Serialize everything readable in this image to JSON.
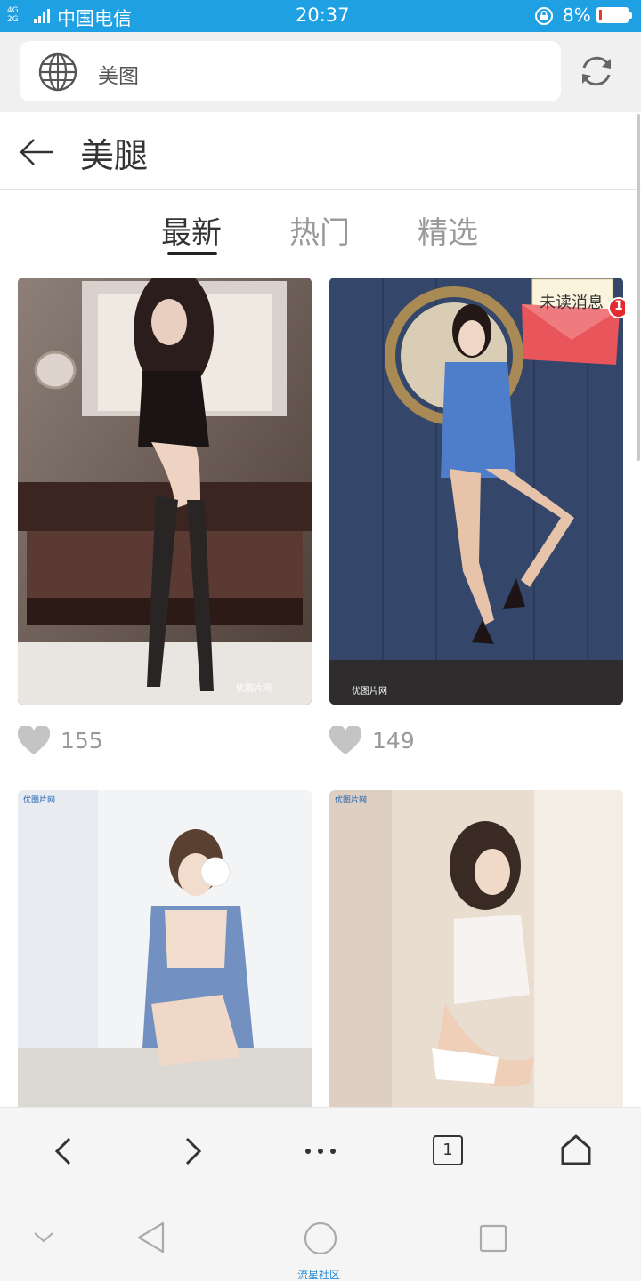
{
  "status_bar": {
    "network": [
      "4G",
      "2G"
    ],
    "carrier": "中国电信",
    "time": "20:37",
    "battery_percent": "8%",
    "battery_level": 0.08,
    "accent_color": "#1fa0e3"
  },
  "address_bar": {
    "text": "美图",
    "site_icon": "globe-icon",
    "action_icon": "refresh-icon"
  },
  "header": {
    "title": "美腿",
    "back_icon": "back-arrow-icon"
  },
  "tabs": [
    {
      "label": "最新",
      "active": true
    },
    {
      "label": "热门",
      "active": false
    },
    {
      "label": "精选",
      "active": false
    }
  ],
  "cards": [
    {
      "likes": "155"
    },
    {
      "likes": "149"
    },
    {
      "likes": ""
    },
    {
      "likes": ""
    }
  ],
  "notification": {
    "label": "未读消息",
    "count": "1"
  },
  "toolbar": {
    "tab_count": "1",
    "icons": [
      "back-icon",
      "forward-icon",
      "more-icon",
      "tabs-icon",
      "home-icon"
    ]
  },
  "system_nav": {
    "icons": [
      "collapse-icon",
      "system-back-icon",
      "system-home-icon",
      "recents-icon"
    ]
  },
  "watermark": "流星社区"
}
